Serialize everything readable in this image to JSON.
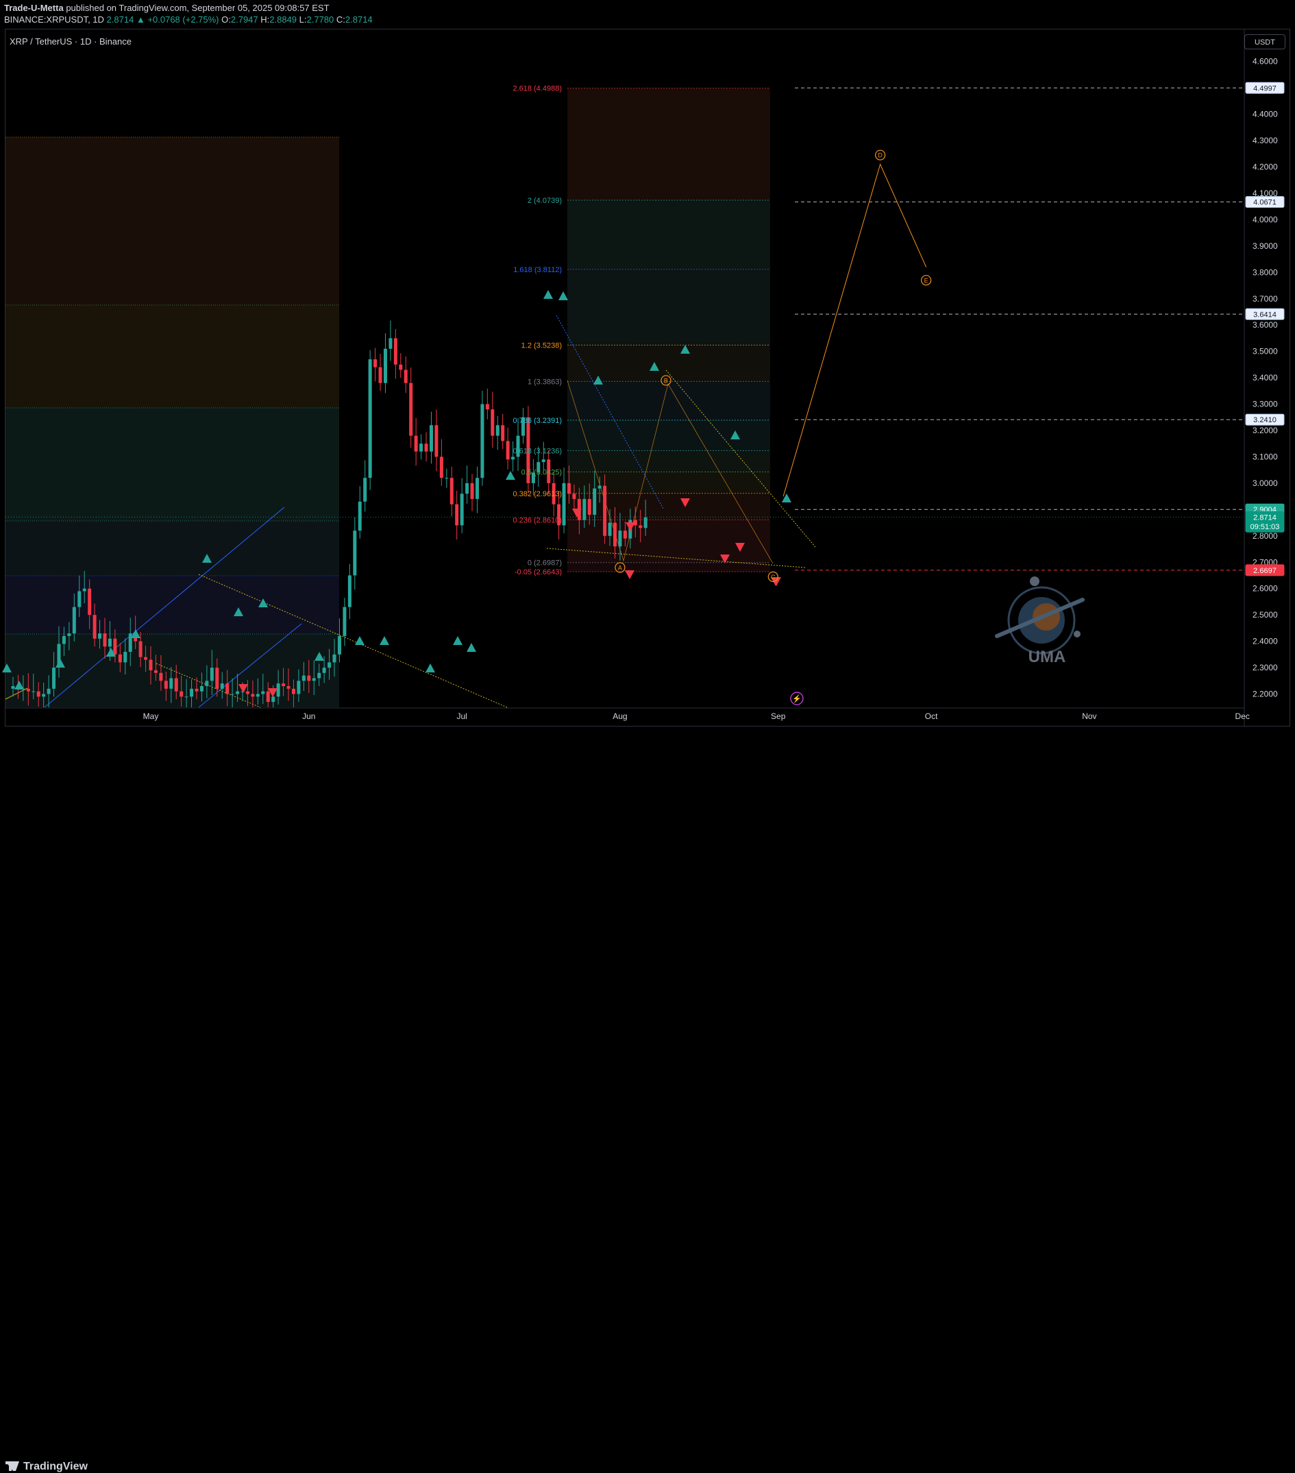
{
  "header": {
    "author": "Trade-U-Metta",
    "published_text": "published on TradingView.com, September 05, 2025 09:08:57 EST",
    "symbol_line": "BINANCE:XRPUSDT, 1D",
    "last": "2.8714",
    "change": "+0.0768 (+2.75%)",
    "open_label": "O:",
    "open": "2.7947",
    "high_label": "H:",
    "high": "2.8849",
    "low_label": "L:",
    "low": "2.7780",
    "close_label": "C:",
    "close": "2.8714"
  },
  "chart_title": "XRP / TetherUS · 1D · Binance",
  "currency_button": "USDT",
  "footer": {
    "logo_text": "TradingView"
  },
  "watermark": "UMA",
  "colors": {
    "up": "#26a69a",
    "down": "#f23645",
    "fib_orange": "#f7931a",
    "fib_red": "#f23645",
    "fib_green": "#26a69a",
    "fib_blue": "#2962ff",
    "projection": "#f7931a",
    "background": "#000000"
  },
  "chart_data": {
    "type": "candlestick",
    "symbol": "XRP / TetherUS",
    "timeframe": "1D",
    "ylim": [
      2.15,
      4.68
    ],
    "y_ticks": [
      "2.2000",
      "2.3000",
      "2.4000",
      "2.5000",
      "2.6000",
      "2.7000",
      "2.8000",
      "2.9000",
      "3.0000",
      "3.1000",
      "3.2000",
      "3.3000",
      "3.4000",
      "3.5000",
      "3.6000",
      "3.7000",
      "3.8000",
      "3.9000",
      "4.0000",
      "4.1000",
      "4.2000",
      "4.3000",
      "4.4000",
      "4.5000",
      "4.6000"
    ],
    "x_labels": [
      {
        "label": "May",
        "day": 0
      },
      {
        "label": "Jun",
        "day": 31
      },
      {
        "label": "Jul",
        "day": 61
      },
      {
        "label": "Aug",
        "day": 92
      },
      {
        "label": "Sep",
        "day": 123
      },
      {
        "label": "Oct",
        "day": 153
      },
      {
        "label": "Nov",
        "day": 184
      },
      {
        "label": "Dec",
        "day": 214
      }
    ],
    "price_labels": [
      {
        "value": "4.4997",
        "price": 4.4997,
        "style": "outline"
      },
      {
        "value": "4.0671",
        "price": 4.0671,
        "style": "outline"
      },
      {
        "value": "3.6414",
        "price": 3.6414,
        "style": "outline"
      },
      {
        "value": "3.2410",
        "price": 3.241,
        "style": "outline"
      },
      {
        "value": "2.9004",
        "price": 2.9004,
        "style": "green"
      },
      {
        "value": "2.8714",
        "price": 2.8714,
        "style": "teal"
      },
      {
        "value": "09:51:03",
        "price": 2.8354,
        "style": "teal"
      },
      {
        "value": "2.6697",
        "price": 2.6697,
        "style": "red"
      }
    ],
    "fib_levels": [
      {
        "label": "2.618 (4.4988)",
        "price": 4.4988,
        "color": "#f23645"
      },
      {
        "label": "2 (4.0739)",
        "price": 4.0739,
        "color": "#26a69a"
      },
      {
        "label": "1.618 (3.8112)",
        "price": 3.8112,
        "color": "#2962ff"
      },
      {
        "label": "1.2 (3.5238)",
        "price": 3.5238,
        "color": "#f7931a"
      },
      {
        "label": "1 (3.3863)",
        "price": 3.3863,
        "color": "#787b86"
      },
      {
        "label": "0.786 (3.2391)",
        "price": 3.2391,
        "color": "#26c6da"
      },
      {
        "label": "0.618 (3.1236)",
        "price": 3.1236,
        "color": "#26a69a"
      },
      {
        "label": "0.5 (3.0425)",
        "price": 3.0425,
        "color": "#4caf50"
      },
      {
        "label": "0.382 (2.9613)",
        "price": 2.9613,
        "color": "#f7931a"
      },
      {
        "label": "0.236 (2.8610)",
        "price": 2.861,
        "color": "#f23645"
      },
      {
        "label": "0 (2.6987)",
        "price": 2.6987,
        "color": "#787b86"
      },
      {
        "label": "-0.05 (2.6643)",
        "price": 2.6643,
        "color": "#f23645"
      }
    ],
    "wave_labels": [
      {
        "label": "A",
        "day": 92,
        "price": 2.68
      },
      {
        "label": "B",
        "day": 101,
        "price": 3.39
      },
      {
        "label": "C",
        "day": 122,
        "price": 2.645
      },
      {
        "label": "D",
        "day": 143,
        "price": 4.245
      },
      {
        "label": "E",
        "day": 152,
        "price": 3.77
      }
    ],
    "projection_path": [
      {
        "day": 124,
        "price": 2.95
      },
      {
        "day": 143,
        "price": 4.21
      },
      {
        "day": 152,
        "price": 3.82
      }
    ],
    "resistance_levels": [
      4.4997,
      4.0671,
      3.6414,
      3.241,
      2.9004
    ],
    "support_level": 2.6697
  }
}
